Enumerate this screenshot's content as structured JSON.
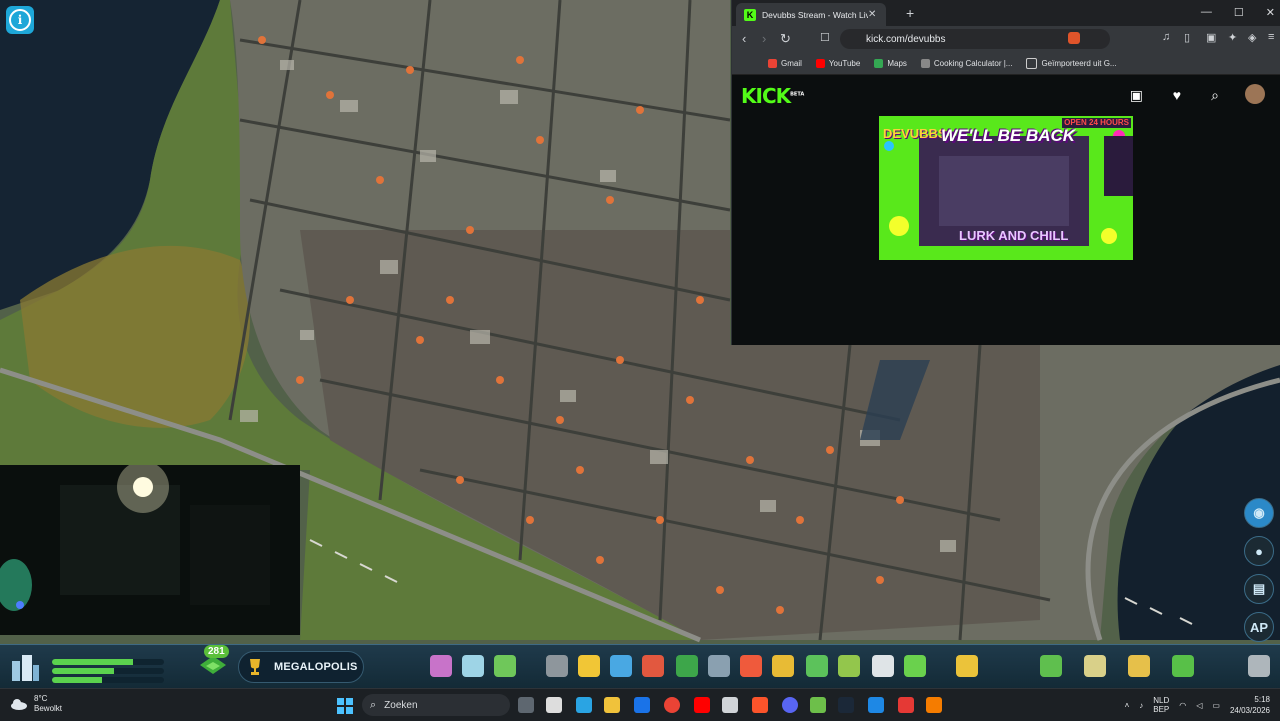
{
  "game": {
    "milestone_name": "MEGALOPOLIS",
    "population_badge": "281",
    "progress_bars": [
      0.72,
      0.55,
      0.45
    ],
    "side_tools": [
      "globe-icon",
      "citizen-icon",
      "notes-icon",
      "AP"
    ],
    "toolbar_icons": [
      "zoning-icon",
      "area-icon",
      "landscaping-icon",
      "roads-icon",
      "electricity-icon",
      "water-icon",
      "health-icon",
      "garbage-icon",
      "education-icon",
      "fire-icon",
      "police-icon",
      "transport-icon",
      "parks-icon",
      "communication-icon",
      "landmarks-icon",
      "signature-icon",
      "districts-icon",
      "map-tiles-icon",
      "budget-icon",
      "policies-icon",
      "bulldozer-icon"
    ]
  },
  "browser": {
    "tab_title": "Devubbs Stream - Watch Live on",
    "url": "kick.com/devubbs",
    "bookmarks": [
      "Gmail",
      "YouTube",
      "Maps",
      "Cooking Calculator |...",
      "Geïmporteerd uit G..."
    ],
    "kick_logo": "KICK",
    "kick_beta": "BETA",
    "player": {
      "brand": "DEVUBBS",
      "headline": "WE'LL BE BACK",
      "open_text": "OPEN 24 HOURS",
      "lurk": "LURK AND CHILL"
    }
  },
  "taskbar": {
    "weather_temp": "8°C",
    "weather_desc": "Bewolkt",
    "search_placeholder": "Zoeken",
    "lang_top": "NLD",
    "lang_bottom": "BEP",
    "time": "5:18",
    "date": "24/03/2026"
  }
}
